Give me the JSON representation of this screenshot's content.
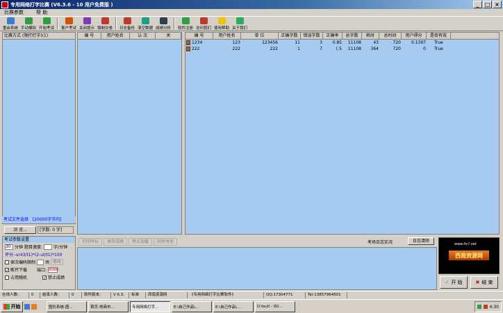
{
  "window": {
    "title": "专用网络打字比赛  (V6.3.6 - 10 用户免费版 )"
  },
  "menu": [
    "比赛参数",
    "帮 助"
  ],
  "toolbar": [
    {
      "label": "重启系统",
      "color": "#3a7bd5"
    },
    {
      "label": "手动模拟",
      "color": "#2e9e44"
    },
    {
      "label": "开始考试",
      "color": "#2e9e44"
    },
    {
      "label": "客户考试",
      "color": "#d35400"
    },
    {
      "label": "关闭提示",
      "color": "#7d3cb5"
    },
    {
      "label": "强制交卷",
      "color": "#c0392b"
    },
    {
      "label": "日志备份",
      "color": "#c0392b"
    },
    {
      "label": "清空数据",
      "color": "#16a085"
    },
    {
      "label": "成绩分析",
      "color": "#2c3e50"
    },
    {
      "label": "软件注册",
      "color": "#2e9e44"
    },
    {
      "label": "访问我们",
      "color": "#c0392b"
    },
    {
      "label": "使用帮助",
      "color": "#f1c40f"
    },
    {
      "label": "关于我们",
      "color": "#27ae60"
    }
  ],
  "left": {
    "heading": "比赛方式 (限打打字)(1)",
    "file_label": "考试文件选择",
    "file_count": "[20000字节内]",
    "browse": "浏 览...",
    "count_label": "[字数: 0 字]"
  },
  "mid_table": {
    "headers": [
      "编 号",
      "用户姓名",
      "认 次",
      "关"
    ]
  },
  "right_table": {
    "headers": [
      "编 号",
      "用户姓名",
      "单 位",
      "正确字数",
      "错误字数",
      "正确率",
      "总字数",
      "耗时",
      "总时间",
      "用户得分",
      "是否有效"
    ],
    "rows": [
      [
        "1234",
        "123",
        "123456",
        "11",
        "3",
        "0.85",
        "11108",
        "43",
        "720",
        "0.1397",
        "True"
      ],
      [
        "222",
        "222",
        "222",
        "1",
        "7",
        "(.5",
        "11108",
        "364",
        "720",
        "0",
        "True"
      ]
    ]
  },
  "settings": {
    "heading": "考试参数设置",
    "minutes": "30",
    "min_label": "分钟",
    "speed_label": "题目速度:",
    "speed_unit": "字/分钟",
    "formula": "评分:-sr43/t1)*(2-ut/t1)*100",
    "opt1": "保次编码限制",
    "opt1_val": "场",
    "opt1_btn": "修改",
    "opt2": "断开下载",
    "port_label": "端口:",
    "port": "8088",
    "opt3": "占用随机",
    "opt4": "禁止成绩"
  },
  "bottom": {
    "btns": [
      "打印所标",
      "保存成绩",
      "停止加载",
      "同步时务"
    ],
    "log_label": "考场日志实况",
    "log_btn": "日志清除"
  },
  "ad": {
    "url": "www.itc?.net",
    "logo": "西南资源网"
  },
  "actions": {
    "start": "开 始",
    "stop": "结 束"
  },
  "status": [
    "在线人数:",
    "0",
    "结束人数:",
    "0",
    "软件版本:",
    "V 6.3.",
    "标准",
    "西南资源网",
    "《专用网络打字比赛软件》",
    "QQ:17304771",
    "Tel:13857964801"
  ],
  "taskbar": {
    "start": "开始",
    "tasks": [
      "图形系统-图...",
      "首页-地商市...",
      "专用网络打字...",
      "E:\\自己作品\\...",
      "E:\\自己作品\\...",
      "D:fault - 80..."
    ],
    "clock": "4:30"
  }
}
